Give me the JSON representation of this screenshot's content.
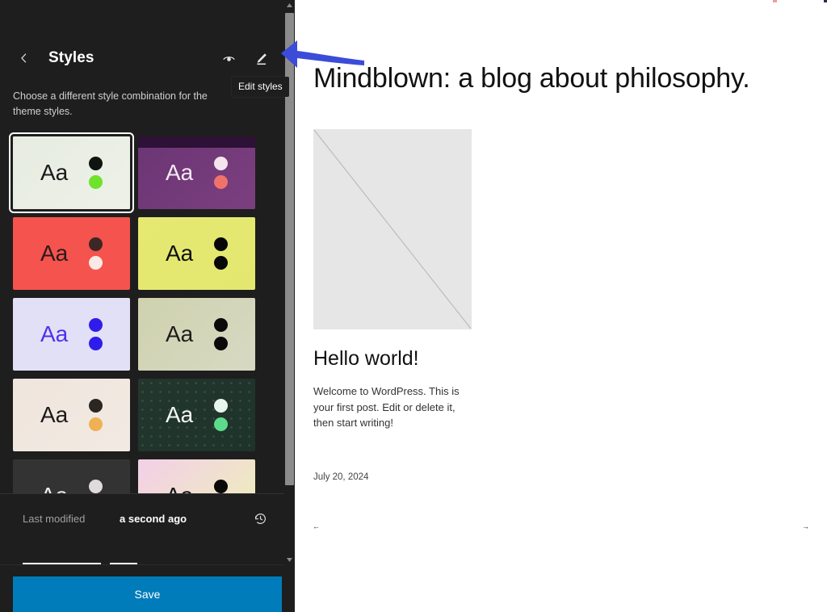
{
  "sidebar": {
    "back_icon": "chevron-left-icon",
    "title": "Styles",
    "actions": [
      {
        "name": "style-book-icon",
        "icon": "eye-icon",
        "label": "Style Book"
      },
      {
        "name": "edit-styles-icon",
        "icon": "pencil-icon",
        "label": "Edit styles"
      }
    ],
    "description": "Choose a different style combination for the theme styles.",
    "tooltip": "Edit styles",
    "variations": [
      {
        "name": "variation-aa-green",
        "label": "Aa",
        "selected": true,
        "bg": "#e7ece1",
        "bg2": "#edf1e8",
        "text_color": "#1a1a1a",
        "dot1": "#101410",
        "dot2": "#6fe22b",
        "topbar": "",
        "pattern": false
      },
      {
        "name": "variation-aa-purple",
        "label": "Aa",
        "selected": false,
        "bg": "#6b3574",
        "bg2": "#7b3f7f",
        "text_color": "#f4e9f4",
        "dot1": "#f4e4ee",
        "dot2": "#f0736a",
        "topbar": "#2e1136",
        "pattern": false
      },
      {
        "name": "variation-aa-red",
        "label": "Aa",
        "selected": false,
        "bg": "#f4534e",
        "bg2": "#f4534e",
        "text_color": "#2b1b1b",
        "dot1": "#3b2726",
        "dot2": "#fbe9e6",
        "topbar": "",
        "pattern": false
      },
      {
        "name": "variation-aa-yellow",
        "label": "Aa",
        "selected": false,
        "bg": "#e5e871",
        "bg2": "#e3e770",
        "text_color": "#101010",
        "dot1": "#070707",
        "dot2": "#070707",
        "topbar": "",
        "pattern": false
      },
      {
        "name": "variation-aa-lavender",
        "label": "Aa",
        "selected": false,
        "bg": "#e2e0f7",
        "bg2": "#e2e0f7",
        "text_color": "#4b32ef",
        "dot1": "#2f1ceb",
        "dot2": "#2f1ceb",
        "topbar": "",
        "pattern": false
      },
      {
        "name": "variation-aa-sage",
        "label": "Aa",
        "selected": false,
        "bg": "#cfd2ae",
        "bg2": "#d7d9c3",
        "text_color": "#1d1d1d",
        "dot1": "#0a0a0a",
        "dot2": "#0a0a0a",
        "topbar": "",
        "pattern": false
      },
      {
        "name": "variation-aa-cream",
        "label": "Aa",
        "selected": false,
        "bg": "#efe5dd",
        "bg2": "#f2eae2",
        "text_color": "#1b1b1b",
        "dot1": "#2a2723",
        "dot2": "#eeb153",
        "topbar": "",
        "pattern": false
      },
      {
        "name": "variation-aa-forest",
        "label": "Aa",
        "selected": false,
        "bg": "#22362c",
        "bg2": "#1e332a",
        "text_color": "#f2f8f2",
        "dot1": "#e8f5ec",
        "dot2": "#5ddb8c",
        "topbar": "",
        "pattern": true
      },
      {
        "name": "variation-aa-charcoal",
        "label": "Aa",
        "selected": false,
        "bg": "#333333",
        "bg2": "#333333",
        "text_color": "#eeeeee",
        "dot1": "#e0dada",
        "dot2": "#f0cfc2",
        "topbar": "",
        "pattern": false
      },
      {
        "name": "variation-aa-pastel",
        "label": "Aa",
        "selected": false,
        "bg": "#f3cfe8",
        "bg2": "#edf0b8",
        "text_color": "#141414",
        "dot1": "#090909",
        "dot2": "#090909",
        "topbar": "",
        "pattern": false
      }
    ],
    "footer": {
      "last_modified_label": "Last modified",
      "last_modified_value": "a second ago",
      "revisions_icon": "history-icon",
      "save_label": "Save"
    },
    "scrollbar": {
      "up_arrow": "▲",
      "down_arrow": "▼"
    }
  },
  "preview": {
    "site_title": "Mindblown: a blog about philosophy.",
    "post": {
      "image_alt": "broken-image-placeholder",
      "title": "Hello world!",
      "excerpt": "Welcome to WordPress. This is your first post. Edit or delete it, then start writing!",
      "date": "July 20, 2024"
    },
    "pager": {
      "prev": "←",
      "next": "→"
    }
  },
  "annotation": {
    "arrow_color": "#3b4cd8",
    "arrow_direction": "left",
    "points_to": "edit-styles-icon"
  }
}
